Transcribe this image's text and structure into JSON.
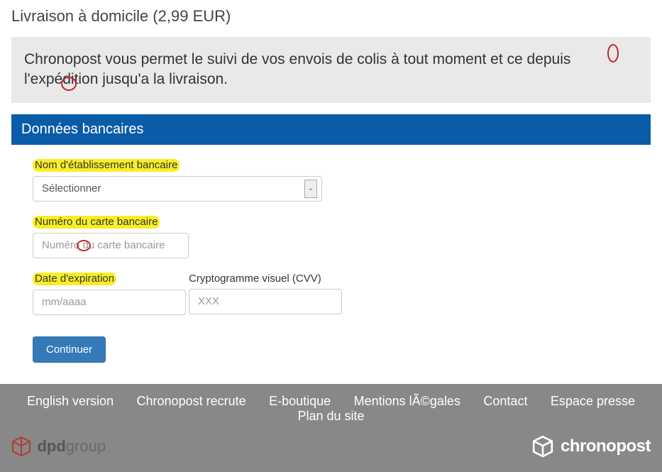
{
  "header": {
    "title": "Livraison à domicile (2,99 EUR)"
  },
  "info": {
    "text": "Chronopost vous permet le suivi de vos envois de colis à tout moment et ce depuis l'expédition jusqu'a la livraison."
  },
  "section": {
    "title": "Données bancaires"
  },
  "form": {
    "bank_name_label": "Nom d'établissement bancaire",
    "bank_name_selected": "Sélectionner",
    "card_num_label": "Numéro du carte bancaire",
    "card_num_placeholder": "Numéro du carte bancaire",
    "exp_label": "Date d'expiration",
    "exp_placeholder": "mm/aaaa",
    "cvv_label": "Cryptogramme visuel (CVV)",
    "cvv_placeholder": "XXX",
    "submit": "Continuer"
  },
  "footer": {
    "links": [
      "English version",
      "Chronopost recrute",
      "E-boutique",
      "Mentions lÃ©gales",
      "Contact",
      "Espace presse",
      "Plan du site"
    ],
    "dpd": {
      "bold": "dpd",
      "light": "group"
    },
    "chrono": "chronopost"
  }
}
